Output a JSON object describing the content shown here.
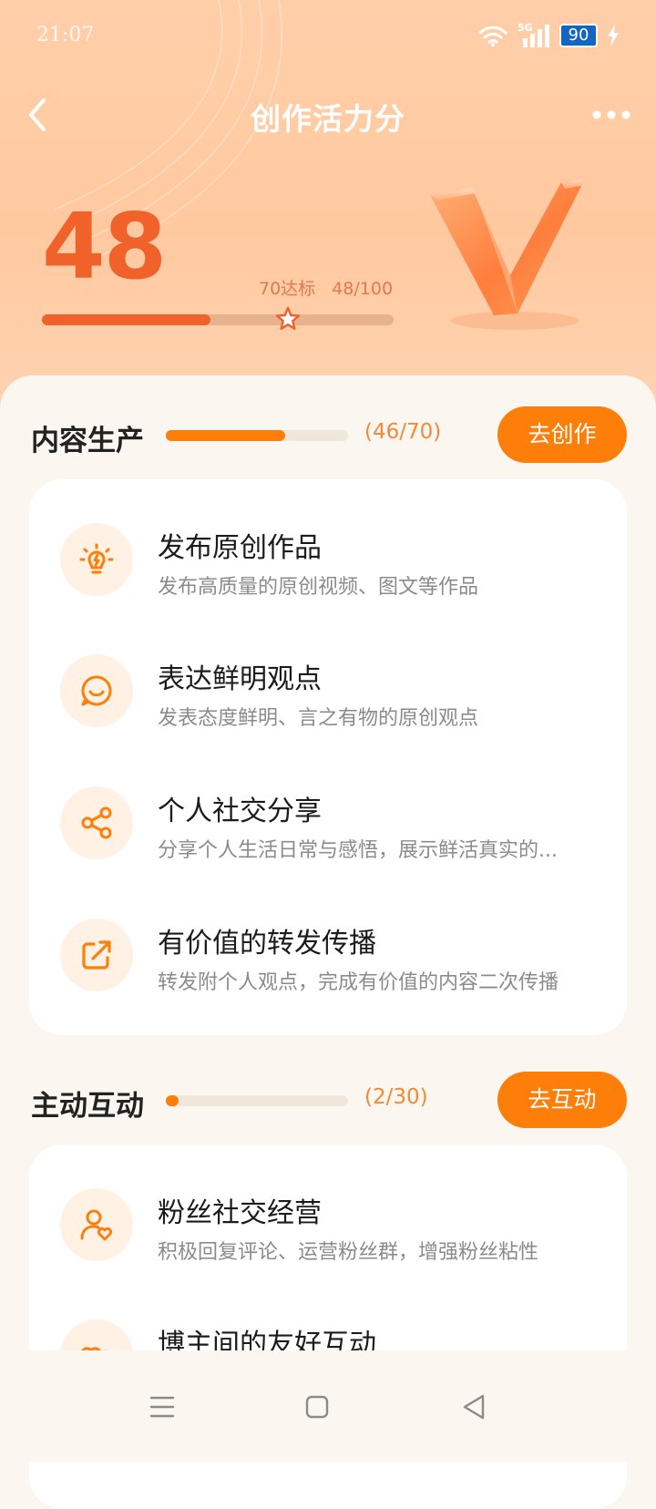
{
  "status_bar": {
    "time": "21:07",
    "network": "5G",
    "battery": "90"
  },
  "header": {
    "title": "创作活力分"
  },
  "score": {
    "value": "48",
    "target_label": "70达标",
    "progress_label": "48/100",
    "progress": 0.48,
    "target_mark": 0.7
  },
  "sections": [
    {
      "title": "内容生产",
      "count": "(46/70)",
      "progress": 0.657,
      "button": "去创作",
      "items": [
        {
          "icon": "lightbulb-icon",
          "title": "发布原创作品",
          "desc": "发布高质量的原创视频、图文等作品"
        },
        {
          "icon": "chat-smile-icon",
          "title": "表达鲜明观点",
          "desc": "发表态度鲜明、言之有物的原创观点"
        },
        {
          "icon": "share-icon",
          "title": "个人社交分享",
          "desc": "分享个人生活日常与感悟，展示鲜活真实的..."
        },
        {
          "icon": "forward-icon",
          "title": "有价值的转发传播",
          "desc": "转发附个人观点，完成有价值的内容二次传播"
        }
      ]
    },
    {
      "title": "主动互动",
      "count": "(2/30)",
      "progress": 0.067,
      "button": "去互动",
      "items": [
        {
          "icon": "fan-user-icon",
          "title": "粉丝社交经营",
          "desc": "积极回复评论、运营粉丝群，增强粉丝粘性"
        },
        {
          "icon": "hearts-icon",
          "title": "博主间的友好互动",
          "desc": ""
        }
      ]
    }
  ],
  "colors": {
    "accent": "#fe7e0a",
    "score": "#f0622a",
    "hero_bg": "#ffcfa9",
    "panel_bg": "#fbf6ef"
  }
}
